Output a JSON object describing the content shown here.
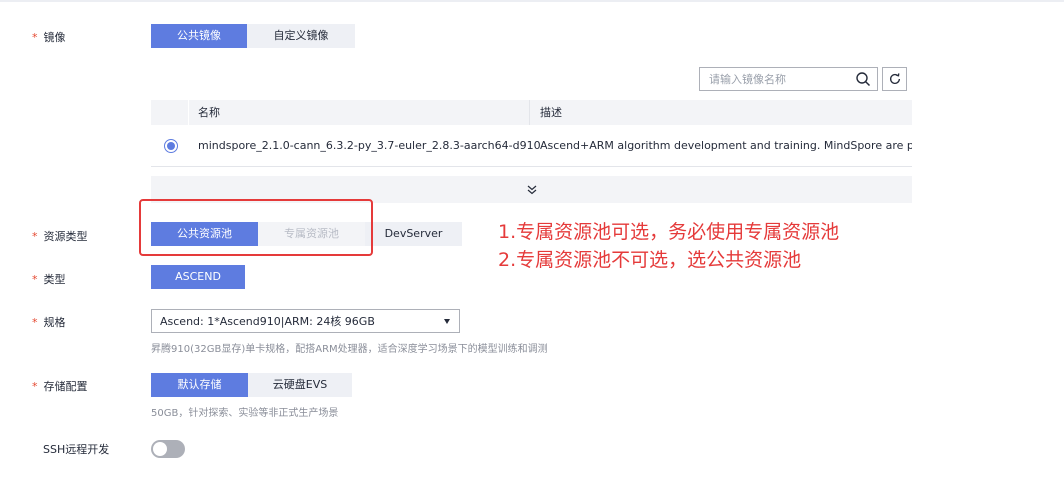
{
  "image": {
    "label": "镜像",
    "tabs": [
      {
        "label": "公共镜像",
        "active": true
      },
      {
        "label": "自定义镜像",
        "active": false
      }
    ],
    "search": {
      "placeholder": "请输入镜像名称",
      "value": ""
    },
    "table": {
      "headers": [
        "名称",
        "描述"
      ],
      "rows": [
        {
          "selected": true,
          "name": "mindspore_2.1.0-cann_6.3.2-py_3.7-euler_2.8.3-aarch64-d910",
          "description": "Ascend+ARM algorithm development and training. MindSpore are prese..."
        }
      ]
    }
  },
  "resource_type": {
    "label": "资源类型",
    "options": [
      {
        "label": "公共资源池",
        "state": "active"
      },
      {
        "label": "专属资源池",
        "state": "disabled"
      },
      {
        "label": "DevServer",
        "state": "normal"
      }
    ]
  },
  "type": {
    "label": "类型",
    "options": [
      {
        "label": "ASCEND",
        "state": "active"
      }
    ]
  },
  "spec": {
    "label": "规格",
    "selected": "Ascend: 1*Ascend910|ARM: 24核 96GB",
    "hint": "昇腾910(32GB显存)单卡规格，配搭ARM处理器，适合深度学习场景下的模型训练和调测"
  },
  "storage": {
    "label": "存储配置",
    "options": [
      {
        "label": "默认存储",
        "state": "active"
      },
      {
        "label": "云硬盘EVS",
        "state": "normal"
      }
    ],
    "hint": "50GB，针对探索、实验等非正式生产场景"
  },
  "ssh": {
    "label": "SSH远程开发",
    "enabled": false
  },
  "annotation": {
    "line1": "1.专属资源池可选，务必使用专属资源池",
    "line2": "2.专属资源池不可选，选公共资源池"
  },
  "colors": {
    "accent": "#5e7ce0",
    "required": "#e5472f",
    "annotation": "#e53a3a"
  }
}
